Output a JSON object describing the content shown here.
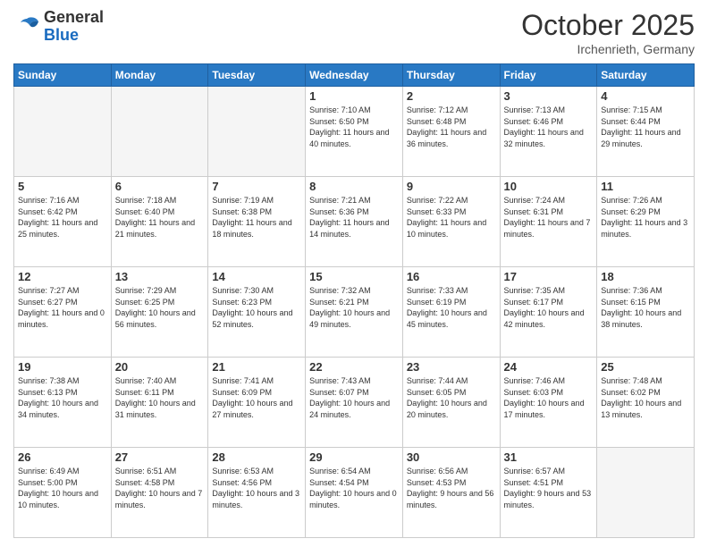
{
  "header": {
    "logo_general": "General",
    "logo_blue": "Blue",
    "month_title": "October 2025",
    "location": "Irchenrieth, Germany"
  },
  "weekdays": [
    "Sunday",
    "Monday",
    "Tuesday",
    "Wednesday",
    "Thursday",
    "Friday",
    "Saturday"
  ],
  "weeks": [
    [
      {
        "day": "",
        "info": ""
      },
      {
        "day": "",
        "info": ""
      },
      {
        "day": "",
        "info": ""
      },
      {
        "day": "1",
        "info": "Sunrise: 7:10 AM\nSunset: 6:50 PM\nDaylight: 11 hours\nand 40 minutes."
      },
      {
        "day": "2",
        "info": "Sunrise: 7:12 AM\nSunset: 6:48 PM\nDaylight: 11 hours\nand 36 minutes."
      },
      {
        "day": "3",
        "info": "Sunrise: 7:13 AM\nSunset: 6:46 PM\nDaylight: 11 hours\nand 32 minutes."
      },
      {
        "day": "4",
        "info": "Sunrise: 7:15 AM\nSunset: 6:44 PM\nDaylight: 11 hours\nand 29 minutes."
      }
    ],
    [
      {
        "day": "5",
        "info": "Sunrise: 7:16 AM\nSunset: 6:42 PM\nDaylight: 11 hours\nand 25 minutes."
      },
      {
        "day": "6",
        "info": "Sunrise: 7:18 AM\nSunset: 6:40 PM\nDaylight: 11 hours\nand 21 minutes."
      },
      {
        "day": "7",
        "info": "Sunrise: 7:19 AM\nSunset: 6:38 PM\nDaylight: 11 hours\nand 18 minutes."
      },
      {
        "day": "8",
        "info": "Sunrise: 7:21 AM\nSunset: 6:36 PM\nDaylight: 11 hours\nand 14 minutes."
      },
      {
        "day": "9",
        "info": "Sunrise: 7:22 AM\nSunset: 6:33 PM\nDaylight: 11 hours\nand 10 minutes."
      },
      {
        "day": "10",
        "info": "Sunrise: 7:24 AM\nSunset: 6:31 PM\nDaylight: 11 hours\nand 7 minutes."
      },
      {
        "day": "11",
        "info": "Sunrise: 7:26 AM\nSunset: 6:29 PM\nDaylight: 11 hours\nand 3 minutes."
      }
    ],
    [
      {
        "day": "12",
        "info": "Sunrise: 7:27 AM\nSunset: 6:27 PM\nDaylight: 11 hours\nand 0 minutes."
      },
      {
        "day": "13",
        "info": "Sunrise: 7:29 AM\nSunset: 6:25 PM\nDaylight: 10 hours\nand 56 minutes."
      },
      {
        "day": "14",
        "info": "Sunrise: 7:30 AM\nSunset: 6:23 PM\nDaylight: 10 hours\nand 52 minutes."
      },
      {
        "day": "15",
        "info": "Sunrise: 7:32 AM\nSunset: 6:21 PM\nDaylight: 10 hours\nand 49 minutes."
      },
      {
        "day": "16",
        "info": "Sunrise: 7:33 AM\nSunset: 6:19 PM\nDaylight: 10 hours\nand 45 minutes."
      },
      {
        "day": "17",
        "info": "Sunrise: 7:35 AM\nSunset: 6:17 PM\nDaylight: 10 hours\nand 42 minutes."
      },
      {
        "day": "18",
        "info": "Sunrise: 7:36 AM\nSunset: 6:15 PM\nDaylight: 10 hours\nand 38 minutes."
      }
    ],
    [
      {
        "day": "19",
        "info": "Sunrise: 7:38 AM\nSunset: 6:13 PM\nDaylight: 10 hours\nand 34 minutes."
      },
      {
        "day": "20",
        "info": "Sunrise: 7:40 AM\nSunset: 6:11 PM\nDaylight: 10 hours\nand 31 minutes."
      },
      {
        "day": "21",
        "info": "Sunrise: 7:41 AM\nSunset: 6:09 PM\nDaylight: 10 hours\nand 27 minutes."
      },
      {
        "day": "22",
        "info": "Sunrise: 7:43 AM\nSunset: 6:07 PM\nDaylight: 10 hours\nand 24 minutes."
      },
      {
        "day": "23",
        "info": "Sunrise: 7:44 AM\nSunset: 6:05 PM\nDaylight: 10 hours\nand 20 minutes."
      },
      {
        "day": "24",
        "info": "Sunrise: 7:46 AM\nSunset: 6:03 PM\nDaylight: 10 hours\nand 17 minutes."
      },
      {
        "day": "25",
        "info": "Sunrise: 7:48 AM\nSunset: 6:02 PM\nDaylight: 10 hours\nand 13 minutes."
      }
    ],
    [
      {
        "day": "26",
        "info": "Sunrise: 6:49 AM\nSunset: 5:00 PM\nDaylight: 10 hours\nand 10 minutes."
      },
      {
        "day": "27",
        "info": "Sunrise: 6:51 AM\nSunset: 4:58 PM\nDaylight: 10 hours\nand 7 minutes."
      },
      {
        "day": "28",
        "info": "Sunrise: 6:53 AM\nSunset: 4:56 PM\nDaylight: 10 hours\nand 3 minutes."
      },
      {
        "day": "29",
        "info": "Sunrise: 6:54 AM\nSunset: 4:54 PM\nDaylight: 10 hours\nand 0 minutes."
      },
      {
        "day": "30",
        "info": "Sunrise: 6:56 AM\nSunset: 4:53 PM\nDaylight: 9 hours\nand 56 minutes."
      },
      {
        "day": "31",
        "info": "Sunrise: 6:57 AM\nSunset: 4:51 PM\nDaylight: 9 hours\nand 53 minutes."
      },
      {
        "day": "",
        "info": ""
      }
    ]
  ]
}
